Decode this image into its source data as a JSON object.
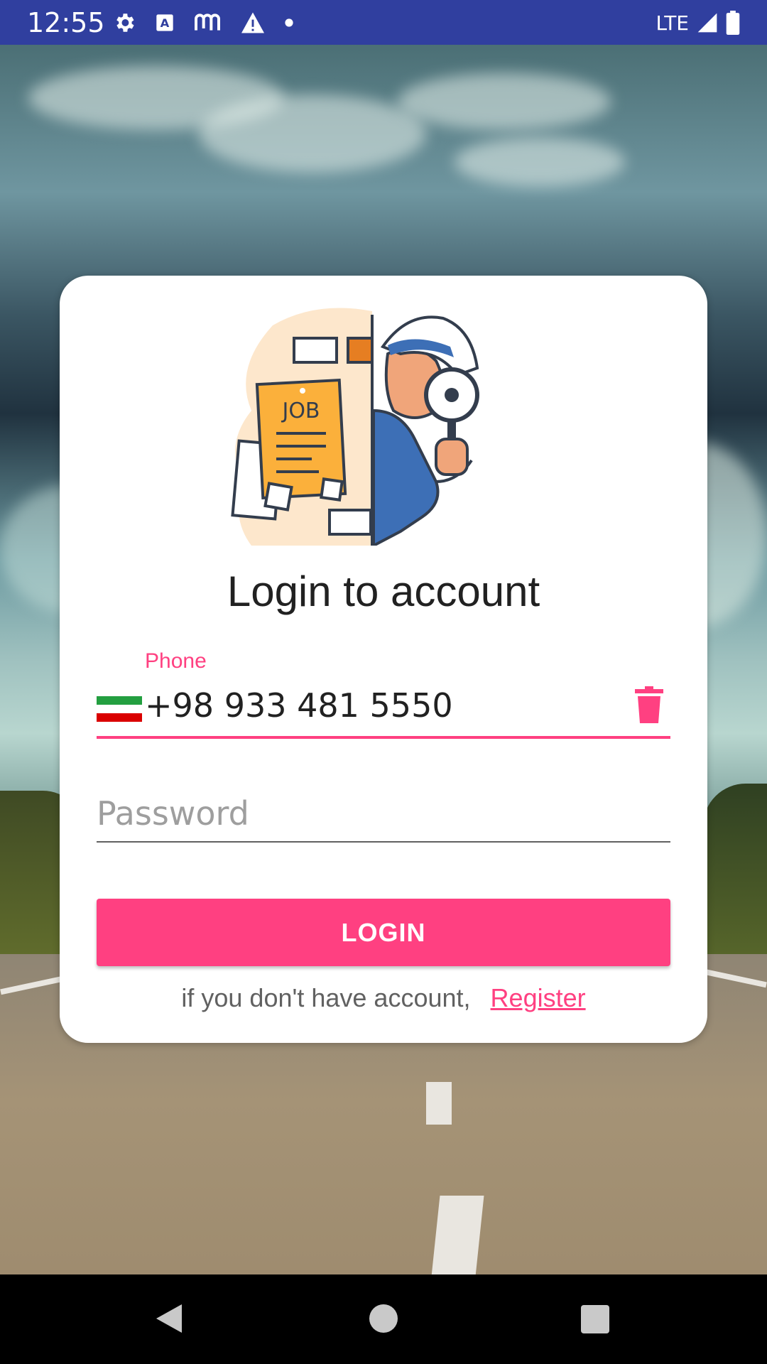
{
  "status_bar": {
    "time": "12:55",
    "network": "LTE",
    "icons": [
      "gear-icon",
      "keyboard-a-icon",
      "m-app-icon",
      "warning-icon",
      "dot-icon",
      "signal-icon",
      "battery-icon"
    ]
  },
  "card": {
    "title": "Login to account",
    "illustration": {
      "job_text": "JOB"
    },
    "phone": {
      "label": "Phone",
      "value": "+98 933 481 5550",
      "country_flag": "iran-flag-icon"
    },
    "password": {
      "placeholder": "Password"
    },
    "login_label": "LOGIN",
    "register_prompt": "if you don't have account,",
    "register_link": "Register"
  },
  "colors": {
    "accent": "#ff4081",
    "status_bar": "#303f9f"
  },
  "nav_bar": {
    "icons": [
      "back-icon",
      "home-icon",
      "recent-apps-icon"
    ]
  }
}
